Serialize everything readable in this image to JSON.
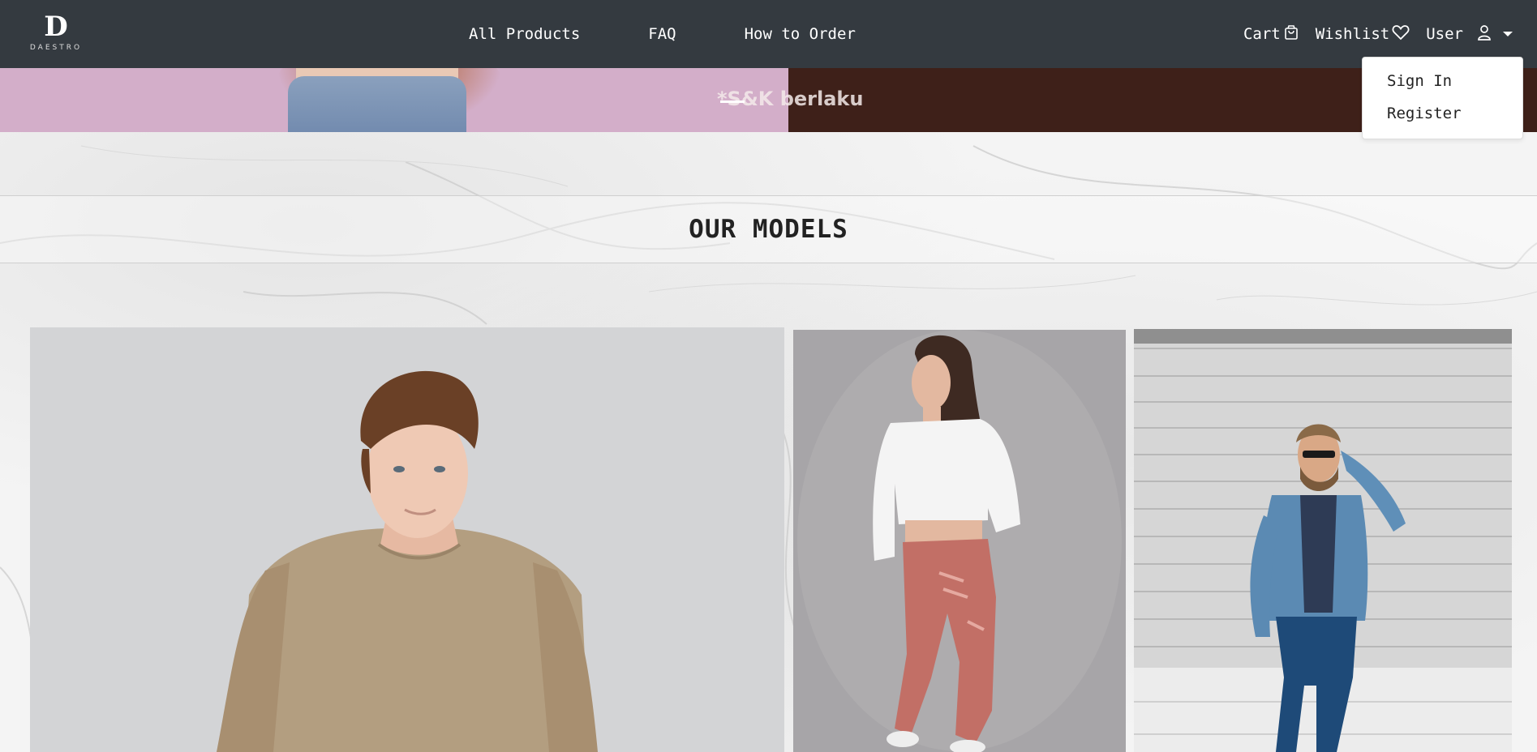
{
  "brand": {
    "logo_mark": "D",
    "logo_text": "DAESTRO"
  },
  "nav": {
    "links": [
      "All Products",
      "FAQ",
      "How to Order"
    ],
    "cart_label": "Cart",
    "wishlist_label": "Wishlist",
    "user_label": "User"
  },
  "user_menu": {
    "items": [
      "Sign In",
      "Register"
    ]
  },
  "banner": {
    "text": "*S&K berlaku"
  },
  "models_section": {
    "title": "OUR MODELS"
  },
  "models": [
    {
      "icon": "model-photo-man-beige-tshirt"
    },
    {
      "icon": "model-photo-woman-white-sweater-pink-joggers"
    },
    {
      "icon": "model-photo-man-blue-blazer-sunglasses"
    }
  ],
  "colors": {
    "navbar": "#343a40",
    "banner_left": "#d3aec9",
    "banner_right": "#3e2019"
  }
}
